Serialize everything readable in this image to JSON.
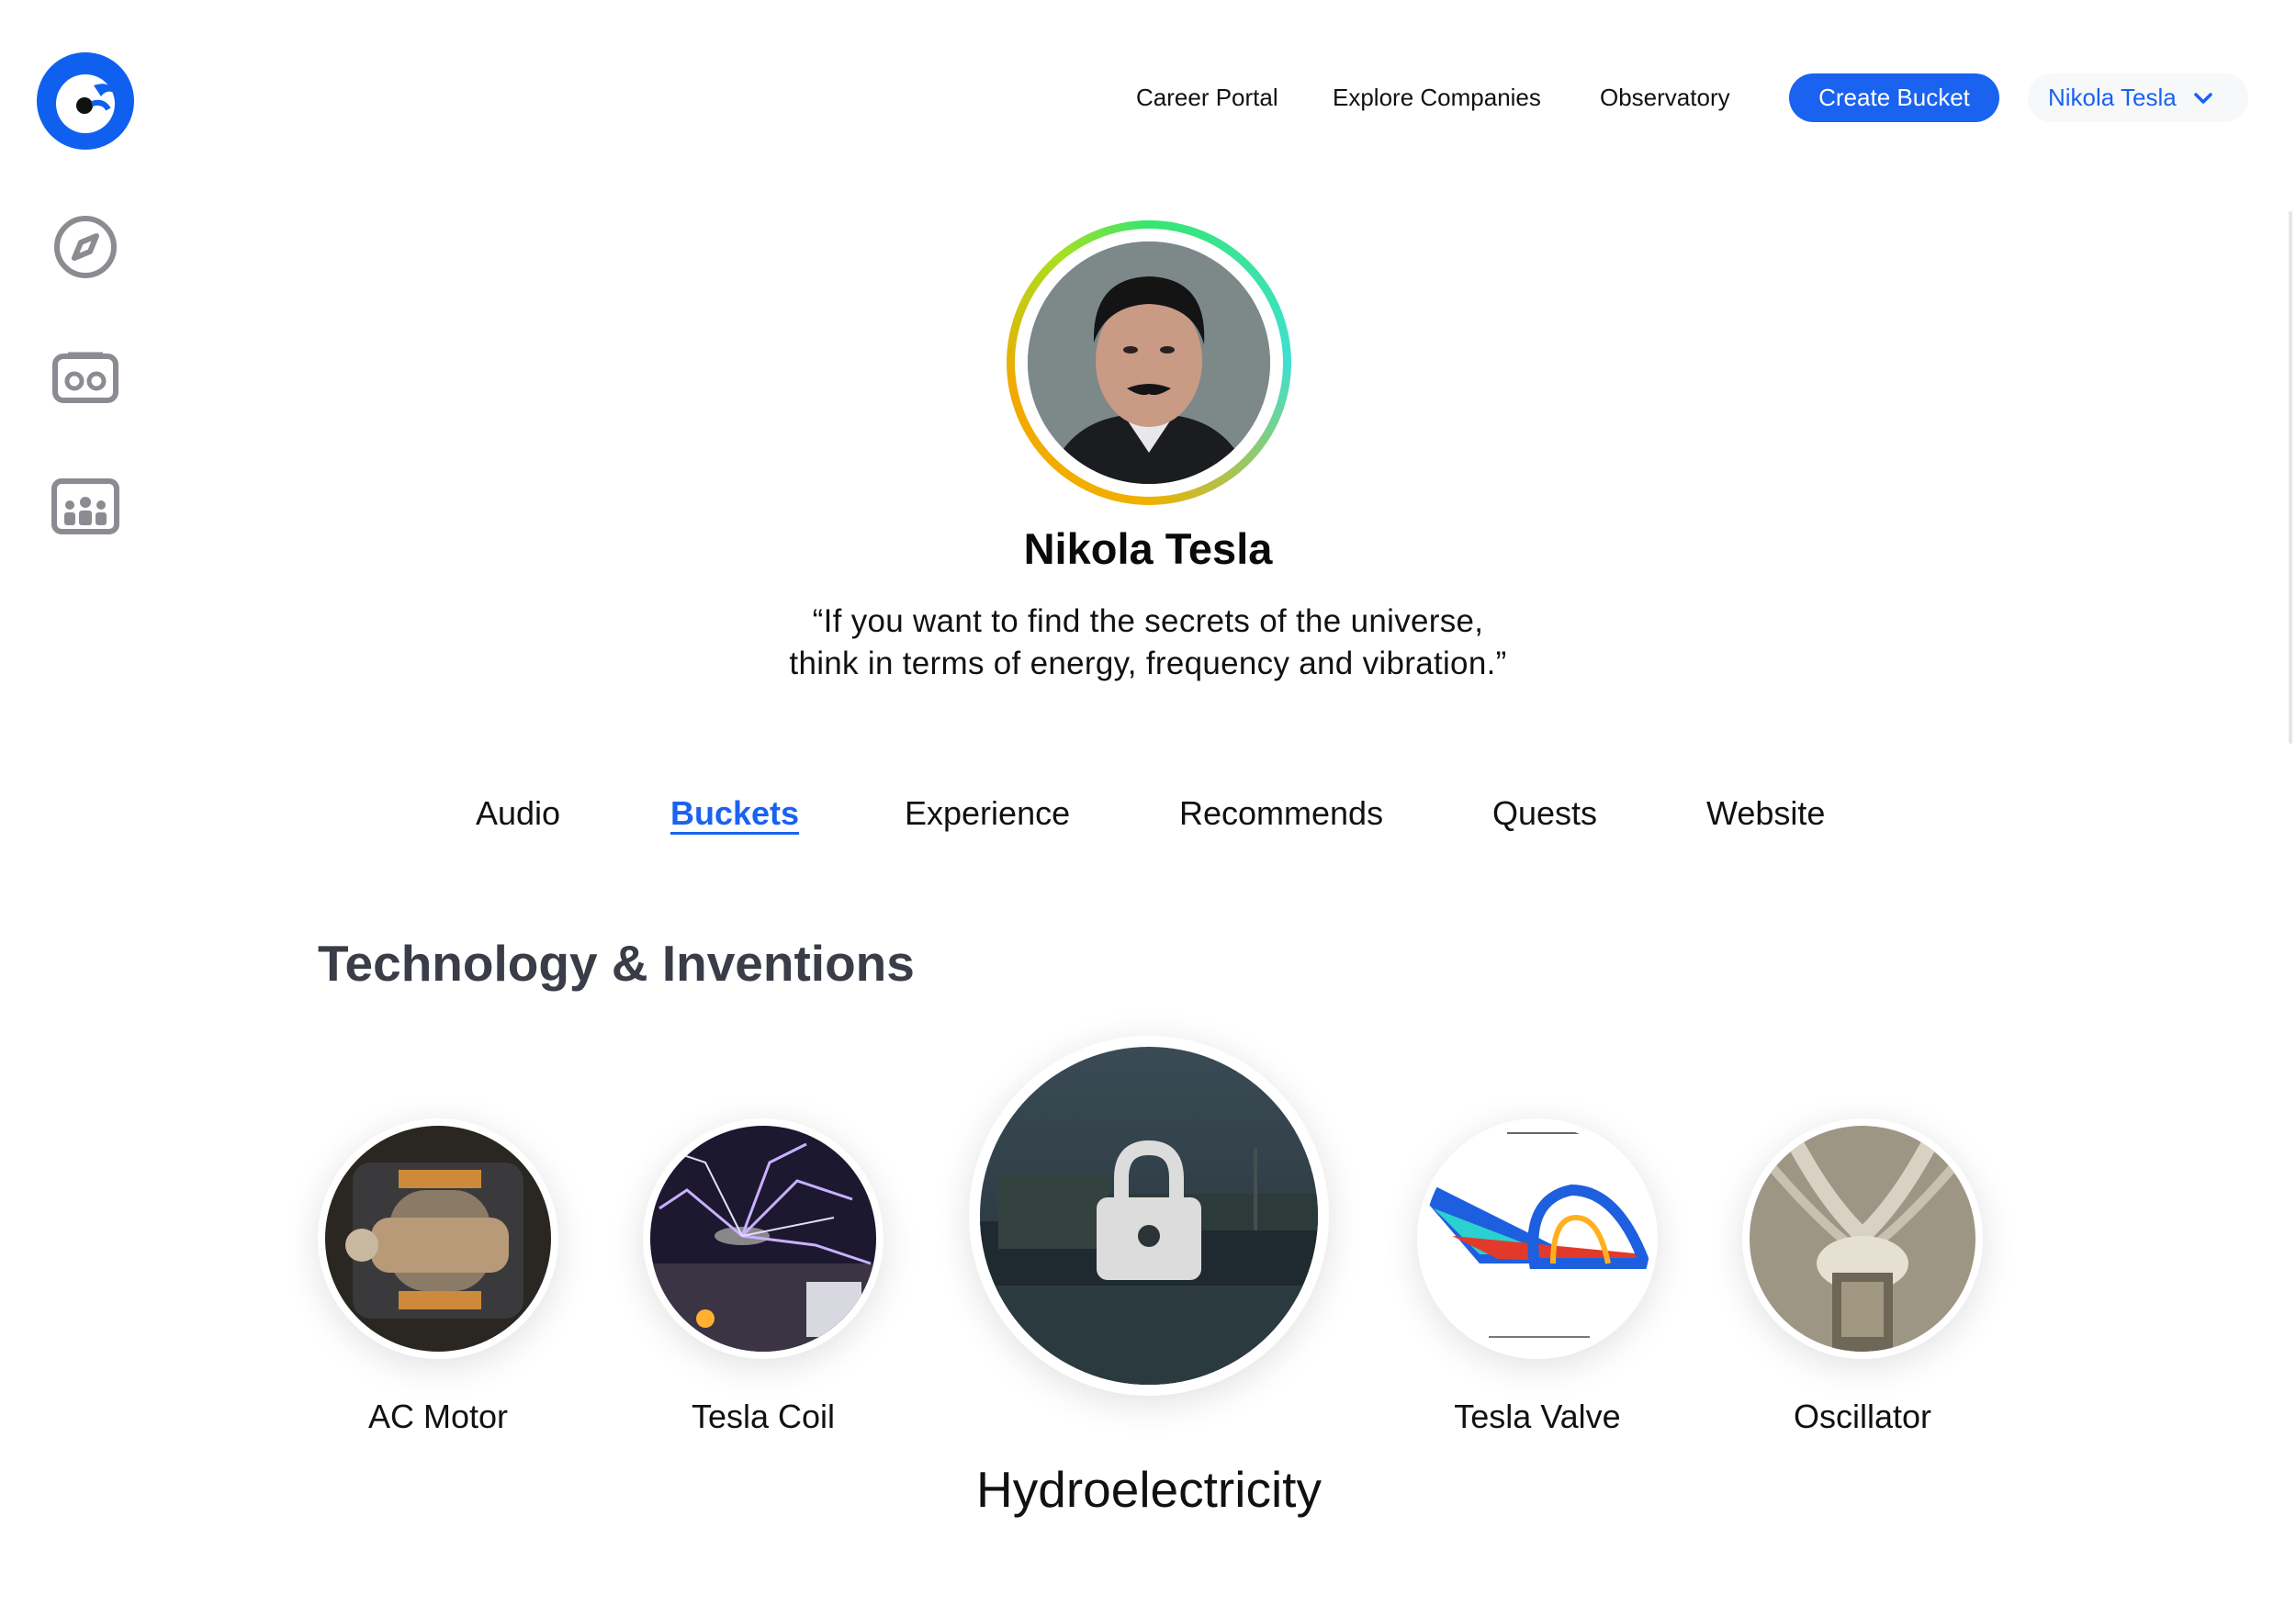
{
  "nav": {
    "links": [
      "Career Portal",
      "Explore Companies",
      "Observatory"
    ],
    "create_label": "Create Bucket",
    "user_label": "Nikola Tesla"
  },
  "profile": {
    "name": "Nikola Tesla",
    "quote_line1": "“If you want to find the secrets of the universe,",
    "quote_line2": "think in terms of energy, frequency and vibration.”"
  },
  "tabs": [
    "Audio",
    "Buckets",
    "Experience",
    "Recommends",
    "Quests",
    "Website"
  ],
  "active_tab": "Buckets",
  "section": {
    "title": "Technology & Inventions",
    "items": [
      {
        "label": "AC Motor",
        "locked": false
      },
      {
        "label": "Tesla Coil",
        "locked": false
      },
      {
        "label": "Hydroelectricity",
        "locked": true
      },
      {
        "label": "Tesla Valve",
        "locked": false
      },
      {
        "label": "Oscillator",
        "locked": false
      }
    ]
  },
  "colors": {
    "accent": "#1a62f0",
    "section_title": "#3a3d47"
  },
  "icons": {
    "logo": "owl-eye-logo",
    "sidebar": [
      "compass-icon",
      "vr-headset-icon",
      "community-icon"
    ],
    "user_menu": "chevron-down-icon",
    "lock": "lock-icon"
  }
}
